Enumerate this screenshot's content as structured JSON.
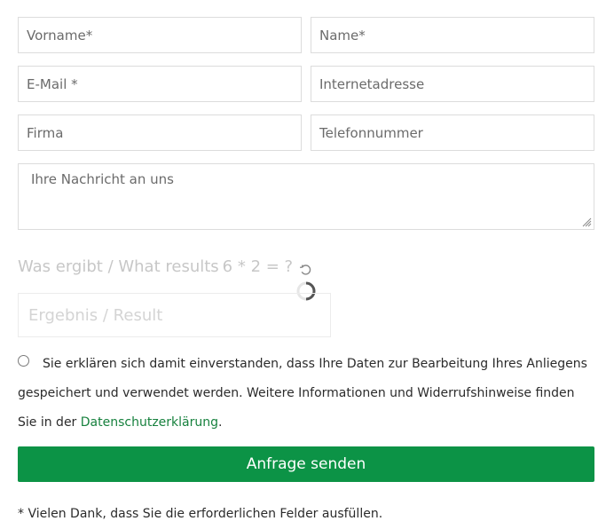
{
  "form": {
    "fields": {
      "first_name_placeholder": "Vorname*",
      "last_name_placeholder": "Name*",
      "email_placeholder": "E-Mail *",
      "website_placeholder": "Internetadresse",
      "company_placeholder": "Firma",
      "phone_placeholder": "Telefonnummer",
      "message_placeholder": "Ihre Nachricht an uns"
    },
    "captcha": {
      "question": "Was ergibt / What results",
      "equation": "6 * 2 = ?",
      "result_placeholder": "Ergebnis / Result"
    },
    "consent": {
      "text": "Sie erklären sich damit einverstanden, dass Ihre Daten zur Bearbeitung Ihres Anliegens gespeichert und verwendet werden. Weitere Informationen und Widerrufshinweise finden Sie in der ",
      "link_label": "Datenschutzerklärung",
      "suffix": "."
    },
    "submit_label": "Anfrage senden",
    "footnote": "* Vielen Dank, dass Sie die erforderlichen Felder ausfüllen."
  },
  "colors": {
    "accent": "#0c9346",
    "link": "#17813e",
    "border": "#dcdcdc",
    "muted": "#c7c7c7"
  },
  "icons": {
    "refresh": "refresh-icon",
    "loading": "loading-spinner-icon",
    "resize": "resize-grip-icon"
  }
}
